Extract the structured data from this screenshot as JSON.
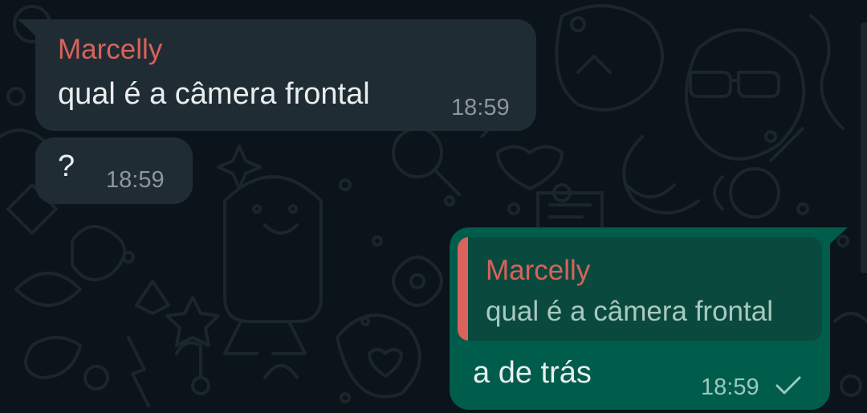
{
  "messages": [
    {
      "direction": "incoming",
      "sender": "Marcelly",
      "text": "qual é a câmera frontal",
      "time": "18:59"
    },
    {
      "direction": "incoming",
      "text": "?",
      "time": "18:59"
    },
    {
      "direction": "outgoing",
      "quoted": {
        "sender": "Marcelly",
        "text": "qual é a câmera frontal"
      },
      "text": "a de trás",
      "time": "18:59",
      "status_icon": "single-check-icon"
    }
  ],
  "colors": {
    "background": "#0b141a",
    "incoming_bubble": "#202c33",
    "outgoing_bubble": "#005c4b",
    "quoted_background": "#0a4a3e",
    "sender_name": "#d7635b",
    "message_text": "#e9edef",
    "timestamp": "#8c979d",
    "wallpaper_doodle": "#1b262c"
  }
}
